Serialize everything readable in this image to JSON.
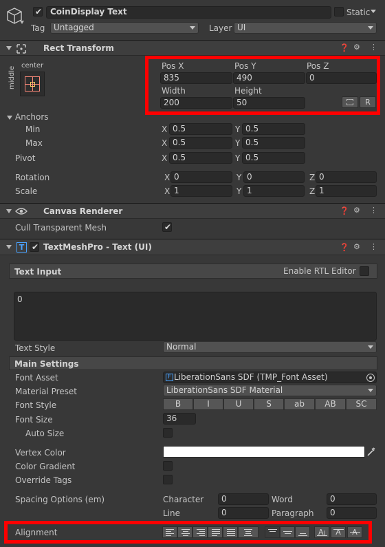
{
  "header": {
    "object_name": "CoinDisplay Text",
    "static_label": "Static",
    "tag_label": "Tag",
    "tag_value": "Untagged",
    "layer_label": "Layer",
    "layer_value": "UI"
  },
  "rect_transform": {
    "title": "Rect Transform",
    "anchor_preset_h": "center",
    "anchor_preset_v": "middle",
    "pos_x_label": "Pos X",
    "pos_y_label": "Pos Y",
    "pos_z_label": "Pos Z",
    "pos_x": "835",
    "pos_y": "490",
    "pos_z": "0",
    "width_label": "Width",
    "height_label": "Height",
    "width": "200",
    "height": "50",
    "r_label": "R",
    "anchors_label": "Anchors",
    "min_label": "Min",
    "max_label": "Max",
    "pivot_label": "Pivot",
    "anchor_min_x": "0.5",
    "anchor_min_y": "0.5",
    "anchor_max_x": "0.5",
    "anchor_max_y": "0.5",
    "pivot_x": "0.5",
    "pivot_y": "0.5",
    "rotation_label": "Rotation",
    "scale_label": "Scale",
    "rot_x": "0",
    "rot_y": "0",
    "rot_z": "0",
    "scale_x": "1",
    "scale_y": "1",
    "scale_z": "1",
    "x": "X",
    "y": "Y",
    "z": "Z"
  },
  "canvas_renderer": {
    "title": "Canvas Renderer",
    "cull_label": "Cull Transparent Mesh",
    "cull_checked": true
  },
  "tmp": {
    "title": "TextMeshPro - Text (UI)",
    "text_input_label": "Text Input",
    "rtl_label": "Enable RTL Editor",
    "text_value": "0",
    "text_style_label": "Text Style",
    "text_style_value": "Normal",
    "main_settings_label": "Main Settings",
    "font_asset_label": "Font Asset",
    "font_asset_value": "LiberationSans SDF (TMP_Font Asset)",
    "material_preset_label": "Material Preset",
    "material_preset_value": "LiberationSans SDF Material",
    "font_style_label": "Font Style",
    "style_b": "B",
    "style_i": "I",
    "style_u": "U",
    "style_s": "S",
    "style_ab_lower": "ab",
    "style_ab_upper": "AB",
    "style_sc": "SC",
    "font_size_label": "Font Size",
    "font_size": "36",
    "auto_size_label": "Auto Size",
    "vertex_color_label": "Vertex Color",
    "vertex_color": "#ffffff",
    "color_gradient_label": "Color Gradient",
    "override_tags_label": "Override Tags",
    "spacing_label": "Spacing Options (em)",
    "character_label": "Character",
    "character_value": "0",
    "word_label": "Word",
    "word_value": "0",
    "line_label": "Line",
    "line_value": "0",
    "paragraph_label": "Paragraph",
    "paragraph_value": "0",
    "alignment_label": "Alignment"
  },
  "colors": {
    "highlight": "#ff0000",
    "panel": "#383838",
    "field": "#2a2a2a",
    "header": "#3e3e3e"
  },
  "icons": [
    "cube-icon",
    "rect-transform-icon",
    "eye-icon",
    "text-icon",
    "help-icon",
    "sliders-icon",
    "kebab-menu-icon",
    "eyedropper-icon",
    "object-picker-icon",
    "blueprint-icon"
  ]
}
